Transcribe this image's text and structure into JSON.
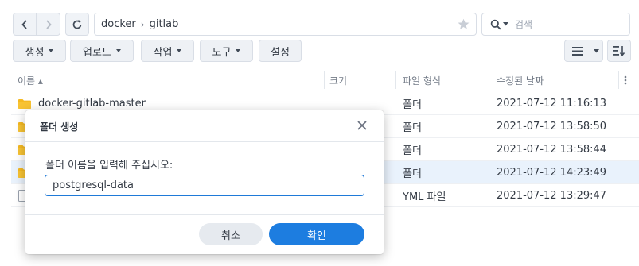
{
  "navigation": {
    "path": [
      "docker",
      "gitlab"
    ],
    "search_placeholder": "검색"
  },
  "toolbar": {
    "create_label": "생성",
    "upload_label": "업로드",
    "action_label": "작업",
    "tools_label": "도구",
    "settings_label": "설정"
  },
  "table": {
    "headers": {
      "name": "이름 ▴",
      "size": "크기",
      "type": "파일 형식",
      "modified": "수정된 날짜"
    },
    "rows": [
      {
        "name": "docker-gitlab-master",
        "type": "폴더",
        "modified": "2021-07-12 11:16:13"
      },
      {
        "name": "",
        "type": "폴더",
        "modified": "2021-07-12 13:58:50"
      },
      {
        "name": "",
        "type": "폴더",
        "modified": "2021-07-12 13:58:44"
      },
      {
        "name": "",
        "type": "폴더",
        "modified": "2021-07-12 14:23:49"
      },
      {
        "name": "",
        "type": "YML 파일",
        "modified": "2021-07-12 13:29:47"
      }
    ]
  },
  "dialog": {
    "title": "폴더 생성",
    "prompt": "폴더 이름을 입력해 주십시오:",
    "input_value": "postgresql-data",
    "cancel_label": "취소",
    "confirm_label": "확인"
  },
  "colors": {
    "accent": "#1d7de0",
    "folder": "#f5b921",
    "selected_row": "#e9f2fc"
  }
}
